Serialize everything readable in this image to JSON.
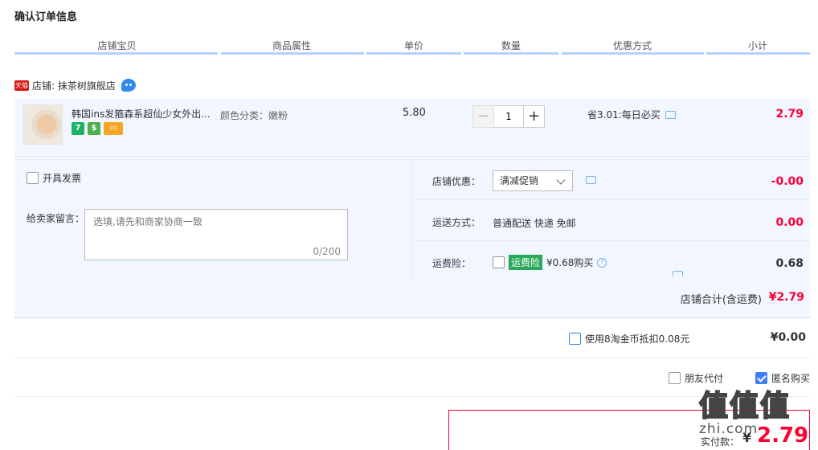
{
  "page": {
    "title": "确认订单信息"
  },
  "columns": [
    "店铺宝贝",
    "商品属性",
    "单价",
    "数量",
    "优惠方式",
    "小计"
  ],
  "shop": {
    "badge": "天猫",
    "label": "店铺: 抹茶树旗舰店"
  },
  "item": {
    "title": "韩国ins发箍森系超仙少女外出...",
    "badges": [
      "7",
      "$"
    ],
    "attribute": "颜色分类：嫩粉",
    "price": "5.80",
    "quantity": "1",
    "qty_minus": "−",
    "qty_plus": "+",
    "discount": "省3.01:每日必买",
    "subtotal": "2.79"
  },
  "options": {
    "invoice_label": "开具发票",
    "memo_label": "给卖家留言：",
    "memo_placeholder": "选填,请先和商家协商一致",
    "memo_count": "0/200",
    "shop_discount_label": "店铺优惠：",
    "shop_discount_selected": "满减促销",
    "shop_discount_value": "-0.00",
    "shipping_label": "运送方式：",
    "shipping_text": "普通配送 快递 免邮",
    "shipping_value": "0.00",
    "insurance_label": "运费险：",
    "insurance_tag": "运费险",
    "insurance_price": "¥0.68购买",
    "insurance_value": "0.68"
  },
  "shop_total": {
    "label": "店铺合计(含运费)",
    "value": "¥2.79"
  },
  "coins": {
    "label": "使用8淘金币抵扣0.08元",
    "value": "¥0.00"
  },
  "proxy": {
    "friend_label": "朋友代付",
    "anon_label": "匿名购买"
  },
  "payment": {
    "label": "实付款：",
    "currency": "¥",
    "amount": "2.79"
  },
  "watermark": {
    "logo": "值值值",
    "url": "zhi.com"
  },
  "colors": {
    "accent_red": "#ff0036",
    "header_line": "#b2d1ff",
    "row_bg": "#f1f6ff",
    "checkbox_blue": "#3d7fff",
    "insurance_green": "#27a85a"
  },
  "state": {
    "invoice_checked": false,
    "insurance_checked": false,
    "coins_checked": false,
    "friend_pay_checked": false,
    "anonymous_checked": true
  }
}
